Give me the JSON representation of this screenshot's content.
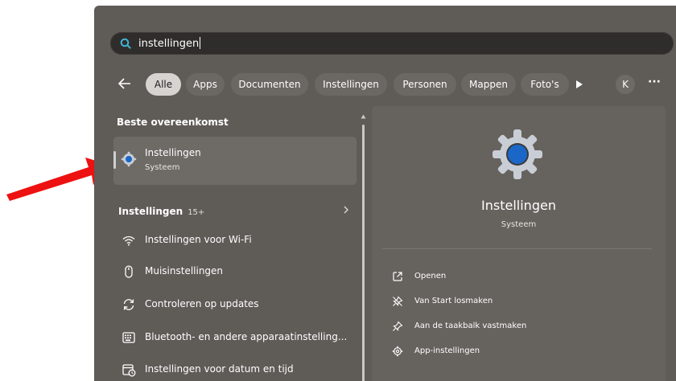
{
  "search": {
    "query": "instellingen"
  },
  "filters": {
    "chips": [
      "Alle",
      "Apps",
      "Documenten",
      "Instellingen",
      "Personen",
      "Mappen",
      "Foto's"
    ],
    "active": "Alle",
    "avatar_initial": "K",
    "more_label": "···"
  },
  "best_match": {
    "section_title": "Beste overeenkomst",
    "name": "Instellingen",
    "subtitle": "Systeem"
  },
  "settings_group": {
    "label": "Instellingen",
    "count": "15+"
  },
  "results": [
    {
      "icon": "wifi-icon",
      "label": "Instellingen voor Wi-Fi"
    },
    {
      "icon": "mouse-icon",
      "label": "Muisinstellingen"
    },
    {
      "icon": "refresh-icon",
      "label": "Controleren op updates"
    },
    {
      "icon": "keyboard-icon",
      "label": "Bluetooth- en andere apparaatinstelling..."
    },
    {
      "icon": "calendar-clock-icon",
      "label": "Instellingen voor datum en tijd"
    }
  ],
  "detail": {
    "title": "Instellingen",
    "subtitle": "Systeem",
    "actions": [
      {
        "icon": "open-external-icon",
        "label": "Openen"
      },
      {
        "icon": "unpin-icon",
        "label": "Van Start losmaken"
      },
      {
        "icon": "pin-icon",
        "label": "Aan de taakbalk vastmaken"
      },
      {
        "icon": "gear-icon",
        "label": "App-instellingen"
      }
    ]
  },
  "colors": {
    "panel": "#5f5b57",
    "accent_blue": "#1a67c8",
    "annotation_arrow": "#ee1111"
  }
}
